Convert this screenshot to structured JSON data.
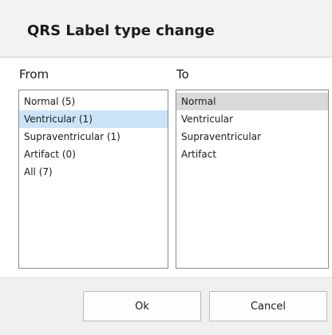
{
  "dialog": {
    "title": "QRS Label type change"
  },
  "from": {
    "label": "From",
    "items": [
      {
        "label": "Normal (5)",
        "selected": false
      },
      {
        "label": "Ventricular (1)",
        "selected": true
      },
      {
        "label": "Supraventricular (1)",
        "selected": false
      },
      {
        "label": "Artifact (0)",
        "selected": false
      },
      {
        "label": "All (7)",
        "selected": false
      }
    ]
  },
  "to": {
    "label": "To",
    "items": [
      {
        "label": "Normal",
        "selected": true
      },
      {
        "label": "Ventricular",
        "selected": false
      },
      {
        "label": "Supraventricular",
        "selected": false
      },
      {
        "label": "Artifact",
        "selected": false
      }
    ]
  },
  "buttons": {
    "ok_label": "Ok",
    "cancel_label": "Cancel"
  },
  "colors": {
    "from_selection": "#cce4f7",
    "to_selection": "#d9d9d9"
  }
}
